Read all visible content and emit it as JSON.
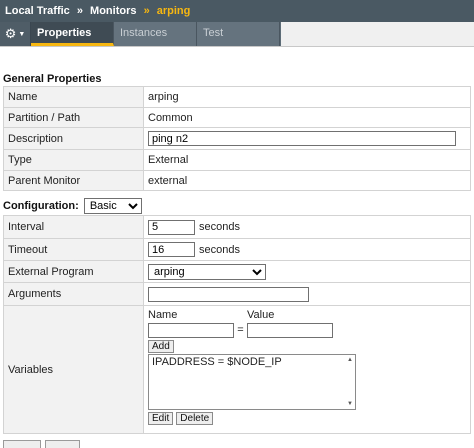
{
  "breadcrumb": {
    "items": [
      "Local Traffic",
      "Monitors"
    ],
    "current": "arping",
    "separator": "»"
  },
  "tabs": {
    "gear_icon": "gear-icon",
    "items": [
      {
        "label": "Properties",
        "active": true
      },
      {
        "label": "Instances",
        "active": false
      },
      {
        "label": "Test",
        "active": false
      }
    ]
  },
  "general": {
    "title": "General Properties",
    "rows": [
      {
        "label": "Name",
        "value": "arping"
      },
      {
        "label": "Partition / Path",
        "value": "Common"
      },
      {
        "label": "Description",
        "value": "ping n2"
      },
      {
        "label": "Type",
        "value": "External"
      },
      {
        "label": "Parent Monitor",
        "value": "external"
      }
    ]
  },
  "configuration": {
    "title": "Configuration:",
    "mode_selected": "Basic",
    "interval": {
      "label": "Interval",
      "value": "5",
      "unit": "seconds"
    },
    "timeout": {
      "label": "Timeout",
      "value": "16",
      "unit": "seconds"
    },
    "external_program": {
      "label": "External Program",
      "selected": "arping"
    },
    "arguments": {
      "label": "Arguments",
      "value": ""
    },
    "variables": {
      "label": "Variables",
      "name_header": "Name",
      "value_header": "Value",
      "equals": "=",
      "add_label": "Add",
      "entries": [
        "IPADDRESS = $NODE_IP"
      ],
      "edit_label": "Edit",
      "delete_label": "Delete"
    }
  },
  "colors": {
    "breadcrumb_bg": "#4a5963",
    "accent": "#f7b711",
    "label_bg": "#f2f2f2"
  }
}
